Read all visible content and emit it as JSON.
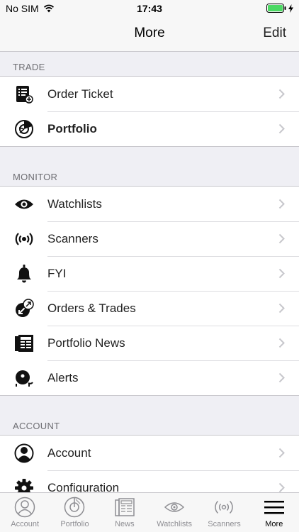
{
  "status_bar": {
    "carrier": "No SIM",
    "time": "17:43"
  },
  "nav": {
    "title": "More",
    "edit_label": "Edit"
  },
  "sections": [
    {
      "header": "TRADE",
      "items": [
        {
          "label": "Order Ticket",
          "icon": "order-ticket-icon"
        },
        {
          "label": "Portfolio",
          "icon": "portfolio-icon"
        }
      ]
    },
    {
      "header": "MONITOR",
      "items": [
        {
          "label": "Watchlists",
          "icon": "eye-icon"
        },
        {
          "label": "Scanners",
          "icon": "scanner-icon"
        },
        {
          "label": "FYI",
          "icon": "bell-icon"
        },
        {
          "label": "Orders & Trades",
          "icon": "orders-trades-icon"
        },
        {
          "label": "Portfolio News",
          "icon": "newspaper-icon"
        },
        {
          "label": "Alerts",
          "icon": "alarm-icon"
        }
      ]
    },
    {
      "header": "ACCOUNT",
      "items": [
        {
          "label": "Account",
          "icon": "user-icon"
        },
        {
          "label": "Configuration",
          "icon": "gear-icon"
        }
      ]
    }
  ],
  "tab_bar": [
    {
      "label": "Account",
      "icon": "user-icon"
    },
    {
      "label": "Portfolio",
      "icon": "portfolio-icon"
    },
    {
      "label": "News",
      "icon": "newspaper-icon"
    },
    {
      "label": "Watchlists",
      "icon": "eye-icon"
    },
    {
      "label": "Scanners",
      "icon": "scanner-icon"
    },
    {
      "label": "More",
      "icon": "menu-icon",
      "active": true
    }
  ],
  "colors": {
    "battery": "#4cd964",
    "separator": "#c8c7cc",
    "section_bg": "#efeff4"
  }
}
